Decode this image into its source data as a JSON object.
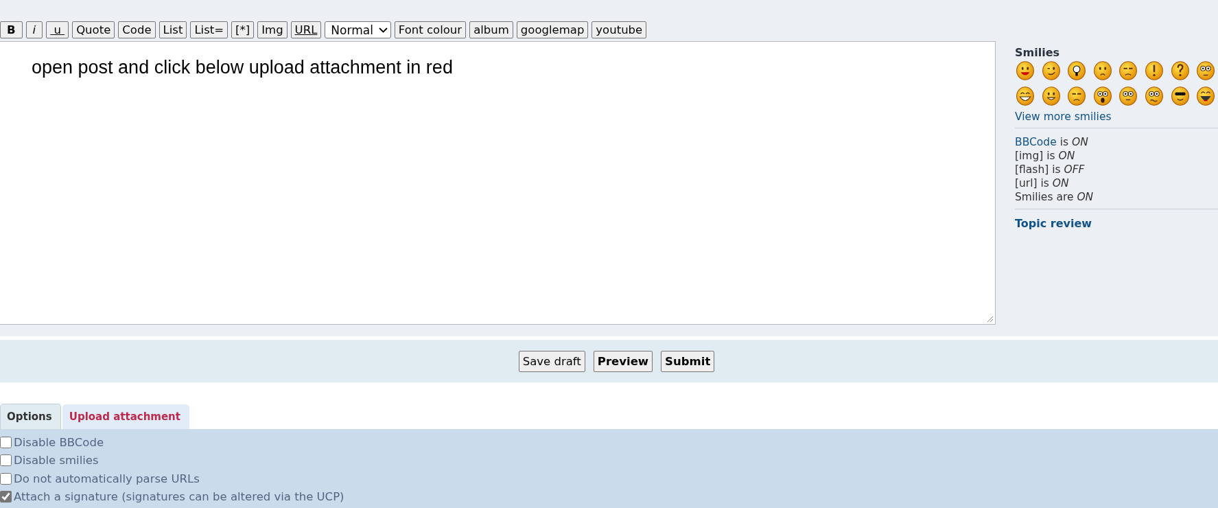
{
  "toolbar": [
    {
      "label": "B",
      "kind": "bold"
    },
    {
      "label": "i",
      "kind": "italic"
    },
    {
      "label": " u ",
      "kind": "underline"
    },
    {
      "label": "Quote",
      "kind": "plain"
    },
    {
      "label": "Code",
      "kind": "plain"
    },
    {
      "label": "List",
      "kind": "plain"
    },
    {
      "label": "List=",
      "kind": "plain"
    },
    {
      "label": "[*]",
      "kind": "plain"
    },
    {
      "label": "Img",
      "kind": "plain"
    },
    {
      "label": "URL",
      "kind": "underline"
    },
    {
      "label": "Normal",
      "kind": "select"
    },
    {
      "label": "Font colour",
      "kind": "plain"
    },
    {
      "label": "album",
      "kind": "plain"
    },
    {
      "label": "googlemap",
      "kind": "plain"
    },
    {
      "label": "youtube",
      "kind": "plain"
    }
  ],
  "editor": {
    "value": "open post and click below upload attachment in red"
  },
  "sidebar": {
    "smilies_title": "Smilies",
    "smilies": [
      {
        "kind": "tongue"
      },
      {
        "kind": "wink"
      },
      {
        "kind": "idea"
      },
      {
        "kind": "sad"
      },
      {
        "kind": "frown"
      },
      {
        "kind": "exclaim"
      },
      {
        "kind": "question"
      },
      {
        "kind": "rolleyes"
      },
      {
        "kind": "laugh"
      },
      {
        "kind": "smile"
      },
      {
        "kind": "frown"
      },
      {
        "kind": "shocked"
      },
      {
        "kind": "geek"
      },
      {
        "kind": "confused"
      },
      {
        "kind": "cool"
      },
      {
        "kind": "lol"
      }
    ],
    "more_link": "View more smilies",
    "status": [
      {
        "link": "BBCode",
        "text": "is *ON*"
      },
      {
        "text": "[img] is *ON*"
      },
      {
        "text": "[flash] is *OFF*"
      },
      {
        "text": "[url] is *ON*"
      },
      {
        "text": "Smilies are *ON*"
      }
    ],
    "topic_review": "Topic review"
  },
  "buttons": [
    {
      "label": "Save draft",
      "primary": false
    },
    {
      "label": "Preview",
      "primary": true
    },
    {
      "label": "Submit",
      "primary": true
    }
  ],
  "tabs": [
    {
      "label": "Options",
      "selected": true
    },
    {
      "label": "Upload attachment",
      "selected": false
    }
  ],
  "options": [
    {
      "label": "Disable BBCode",
      "checked": false
    },
    {
      "label": "Disable smilies",
      "checked": false
    },
    {
      "label": "Do not automatically parse URLs",
      "checked": false
    },
    {
      "label": "Attach a signature (signatures can be altered via the UCP)",
      "checked": true
    }
  ]
}
